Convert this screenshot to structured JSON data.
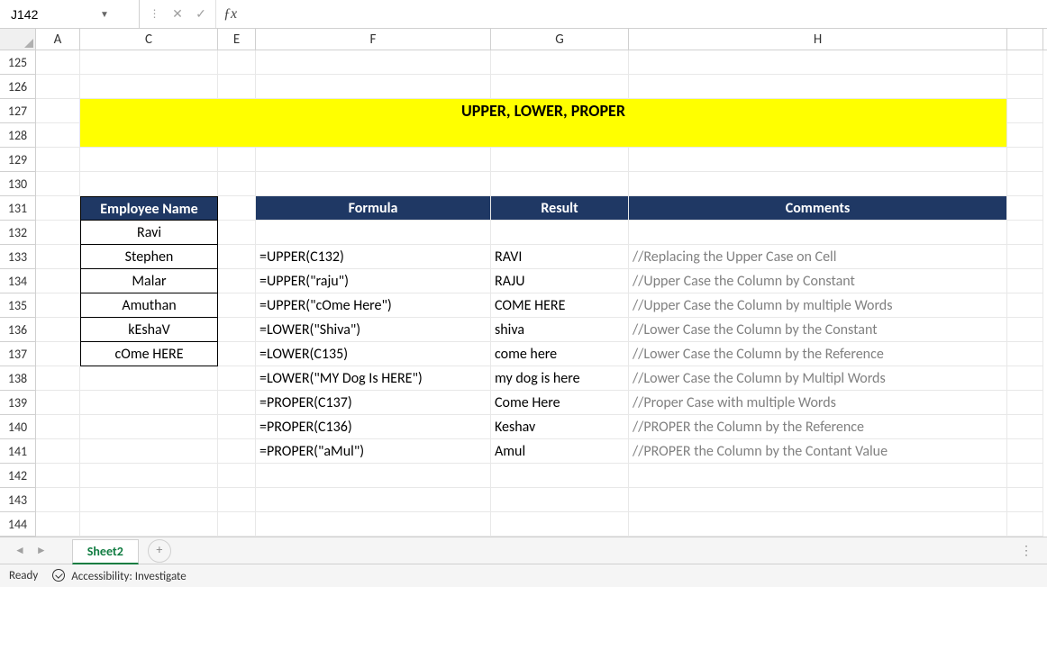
{
  "formulaBar": {
    "nameBox": "J142",
    "formula": ""
  },
  "columns": [
    "A",
    "C",
    "E",
    "F",
    "G",
    "H"
  ],
  "rows": [
    "125",
    "126",
    "127",
    "128",
    "129",
    "130",
    "131",
    "132",
    "133",
    "134",
    "135",
    "136",
    "137",
    "138",
    "139",
    "140",
    "141",
    "142",
    "143",
    "144"
  ],
  "banner": "UPPER, LOWER, PROPER",
  "headers": {
    "employee": "Employee Name",
    "formula": "Formula",
    "result": "Result",
    "comments": "Comments"
  },
  "employees": [
    "Ravi",
    "Stephen",
    "Malar",
    "Amuthan",
    "kEshaV",
    "cOme HERE"
  ],
  "table": [
    {
      "formula": "=UPPER(C132)",
      "result": "RAVI",
      "comment": "//Replacing the Upper Case on Cell"
    },
    {
      "formula": "=UPPER(\"raju\")",
      "result": "RAJU",
      "comment": "//Upper Case the Column by Constant"
    },
    {
      "formula": "=UPPER(\"cOme Here\")",
      "result": "COME HERE",
      "comment": "//Upper Case the Column by multiple Words"
    },
    {
      "formula": "=LOWER(\"Shiva\")",
      "result": "shiva",
      "comment": "//Lower Case the Column by the Constant"
    },
    {
      "formula": "=LOWER(C135)",
      "result": "come here",
      "comment": "//Lower Case the Column by the Reference"
    },
    {
      "formula": "=LOWER(\"MY Dog Is HERE\")",
      "result": "my dog is here",
      "comment": "//Lower Case the Column by Multipl Words"
    },
    {
      "formula": "=PROPER(C137)",
      "result": "Come Here",
      "comment": "//Proper Case with multiple Words"
    },
    {
      "formula": "=PROPER(C136)",
      "result": "Keshav",
      "comment": "//PROPER the Column by the Reference"
    },
    {
      "formula": "=PROPER(\"aMul\")",
      "result": "Amul",
      "comment": "//PROPER the Column by the Contant Value"
    }
  ],
  "sheetTabs": {
    "active": "Sheet2",
    "add": "+"
  },
  "statusBar": {
    "ready": "Ready",
    "accessibility": "Accessibility: Investigate"
  }
}
